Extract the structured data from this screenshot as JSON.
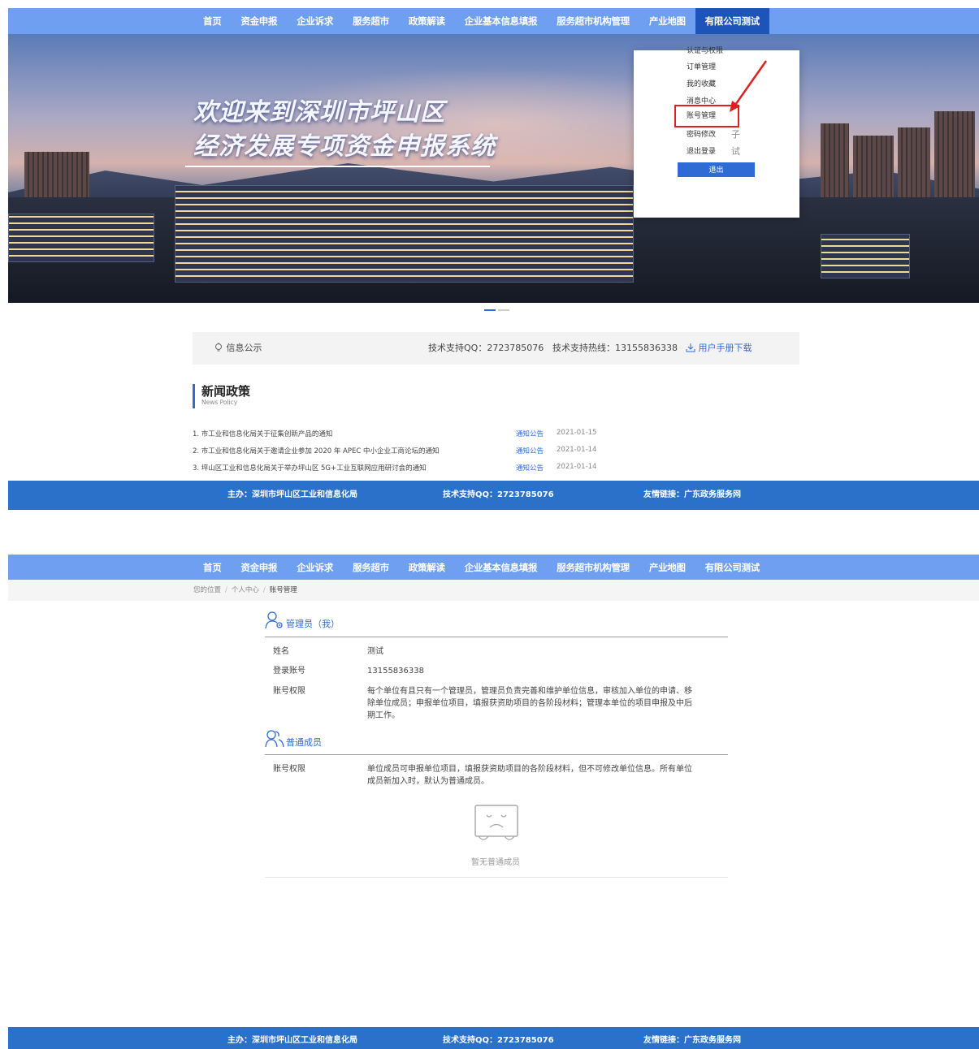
{
  "nav": {
    "items": [
      "首页",
      "资金申报",
      "企业诉求",
      "服务超市",
      "政策解读",
      "企业基本信息填报",
      "服务超市机构管理",
      "产业地图",
      "有限公司测试"
    ],
    "active_index": 8
  },
  "banner": {
    "title_line1": "欢迎来到深圳市坪山区",
    "title_line2": "经济发展专项资金申报系统"
  },
  "dropdown": {
    "items": [
      "认证与权限",
      "订单管理",
      "我的收藏",
      "消息中心",
      "账号管理",
      "密码修改",
      "退出登录"
    ],
    "highlighted_index": 4,
    "ghost_text_1": "子",
    "ghost_text_2": "试",
    "logout_button": "退出"
  },
  "info_bar": {
    "notice": "信息公示",
    "qq": "技术支持QQ：2723785076",
    "hotline": "技术支持热线：13155836338",
    "manual_download": "用户手册下载"
  },
  "news": {
    "title": "新闻政策",
    "subtitle": "News Policy",
    "rows": [
      {
        "title": "1. 市工业和信息化局关于征集创新产品的通知",
        "category": "通知公告",
        "date": "2021-01-15"
      },
      {
        "title": "2. 市工业和信息化局关于邀请企业参加 2020 年 APEC 中小企业工商论坛的通知",
        "category": "通知公告",
        "date": "2021-01-14"
      },
      {
        "title": "3. 坪山区工业和信息化局关于举办坪山区 5G+工业互联网应用研讨会的通知",
        "category": "通知公告",
        "date": "2021-01-14"
      }
    ]
  },
  "footer": {
    "host": "主办：深圳市坪山区工业和信息化局",
    "qq": "技术支持QQ：2723785076",
    "links": "友情链接：广东政务服务网"
  },
  "breadcrumb": [
    "您的位置",
    "个人中心",
    "账号管理"
  ],
  "admin": {
    "heading": "管理员（我）",
    "name_label": "姓名",
    "name_value": "测试",
    "account_label": "登录账号",
    "account_value": "13155836338",
    "perm_label": "账号权限",
    "perm_value": "每个单位有且只有一个管理员，管理员负责完善和维护单位信息，审核加入单位的申请、移除单位成员；申报单位项目，填报获资助项目的各阶段材料；管理本单位的项目申报及中后期工作。"
  },
  "member": {
    "heading": "普通成员",
    "perm_label": "账号权限",
    "perm_value": "单位成员可申报单位项目，填报获资助项目的各阶段材料，但不可修改单位信息。所有单位成员新加入时，默认为普通成员。",
    "empty_text": "暂无普通成员"
  },
  "colors": {
    "nav_bg": "#6f9ff0",
    "nav_active": "#1c54b8",
    "footer_bg": "#2b70c9",
    "accent": "#2f6bd5",
    "highlight_red": "#e02020"
  }
}
